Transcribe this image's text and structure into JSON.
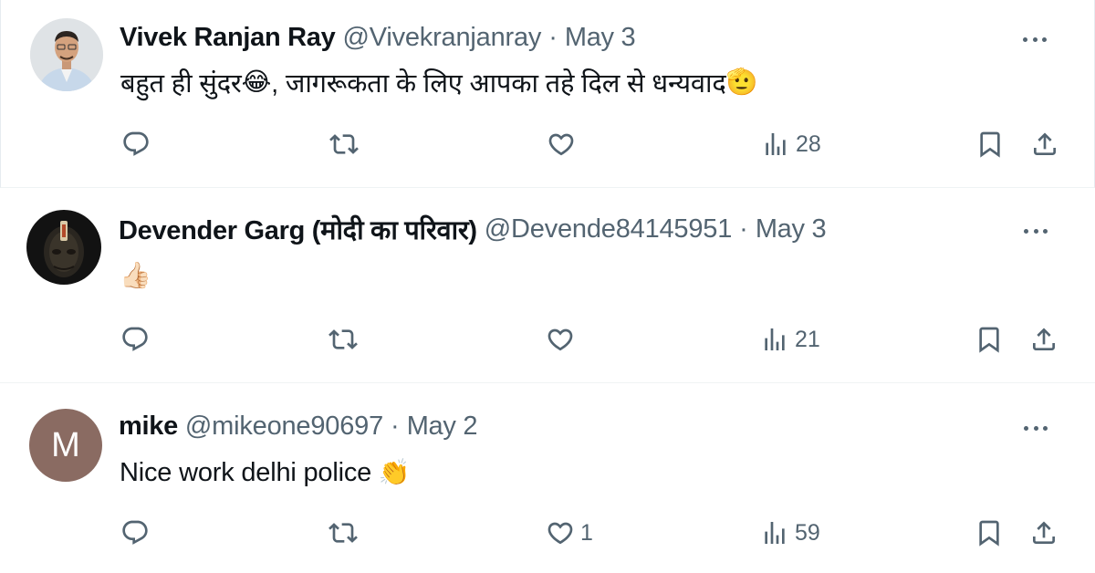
{
  "tweets": [
    {
      "name": "Vivek Ranjan Ray",
      "handle": "@Vivekranjanray",
      "separator": "·",
      "date": "May 3",
      "text": "बहुत ही सुंदर",
      "emoji1": "😂",
      "text2": ", जागरूकता के लिए आपका तहे दिल से धन्यवाद",
      "emoji2": "🫡",
      "views": "28",
      "likes": ""
    },
    {
      "name": "Devender Garg (मोदी का परिवार)",
      "handle": "@Devende84145951",
      "separator": "·",
      "date": "May 3",
      "emoji1": "👍🏻",
      "views": "21",
      "likes": ""
    },
    {
      "name": "mike",
      "handle": "@mikeone90697",
      "separator": "·",
      "date": "May 2",
      "text": "Nice work delhi police ",
      "emoji1": "👏",
      "avatar_letter": "M",
      "views": "59",
      "likes": "1"
    }
  ],
  "icons": {
    "reply": "reply-icon",
    "retweet": "retweet-icon",
    "like": "like-icon",
    "views": "views-icon",
    "bookmark": "bookmark-icon",
    "share": "share-icon",
    "more": "more-icon"
  },
  "colors": {
    "text": "#0f1419",
    "secondary": "#536471",
    "border": "#eff3f4"
  }
}
